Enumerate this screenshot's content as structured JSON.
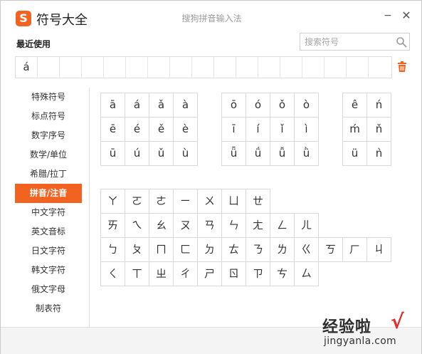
{
  "app": {
    "logo_letter": "S",
    "title": "符号大全",
    "ime_title": "搜狗拼音输入法",
    "minimize": "−",
    "close": "✕",
    "accent": "#f26322"
  },
  "recent": {
    "label": "最近使用",
    "items": [
      "á",
      "",
      "",
      "",
      "",
      "",
      "",
      "",
      "",
      "",
      "",
      "",
      "",
      "",
      "",
      "",
      ""
    ],
    "trash_icon": "trash-icon"
  },
  "search": {
    "placeholder": "搜索符号"
  },
  "sidebar": {
    "items": [
      {
        "label": "特殊符号"
      },
      {
        "label": "标点符号"
      },
      {
        "label": "数字序号"
      },
      {
        "label": "数学/单位"
      },
      {
        "label": "希腊/拉丁"
      },
      {
        "label": "拼音/注音",
        "active": true
      },
      {
        "label": "中文字符"
      },
      {
        "label": "英文音标"
      },
      {
        "label": "日文字符"
      },
      {
        "label": "韩文字符"
      },
      {
        "label": "俄文字母"
      },
      {
        "label": "制表符"
      }
    ]
  },
  "pinyin": {
    "group_a": [
      "ā",
      "á",
      "ǎ",
      "à",
      "ē",
      "é",
      "ě",
      "è",
      "ū",
      "ú",
      "ǔ",
      "ù"
    ],
    "group_o": [
      "ō",
      "ó",
      "ǒ",
      "ò",
      "ī",
      "í",
      "ǐ",
      "ì",
      "ǖ",
      "ǘ",
      "ǚ",
      "ǜ"
    ],
    "group_e": [
      "ê",
      "ń",
      "ḿ",
      "ň",
      "ü",
      "ǹ"
    ]
  },
  "zhuyin": {
    "row1": [
      "ㄚ",
      "ㄛ",
      "ㄜ",
      "ㄧ",
      "ㄨ",
      "ㄩ",
      "ㄝ"
    ],
    "row2": [
      "ㄞ",
      "ㄟ",
      "ㄠ",
      "ㄡ",
      "ㄢ",
      "ㄣ",
      "ㄤ",
      "ㄥ",
      "ㄦ"
    ],
    "row3": [
      "ㄅ",
      "ㄆ",
      "ㄇ",
      "ㄈ",
      "ㄉ",
      "ㄊ",
      "ㄋ",
      "ㄌ",
      "ㄍ",
      "ㄎ",
      "ㄏ",
      "ㄐ"
    ],
    "row4": [
      "ㄑ",
      "ㄒ",
      "ㄓ",
      "ㄔ",
      "ㄕ",
      "ㄖ",
      "ㄗ",
      "ㄘ",
      "ㄙ"
    ]
  },
  "watermark": {
    "cn": "经验啦",
    "check": "√",
    "url": "jingyanla.com"
  }
}
